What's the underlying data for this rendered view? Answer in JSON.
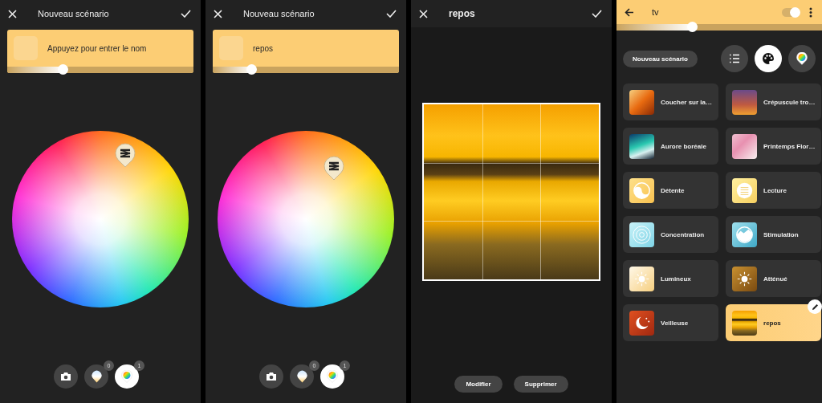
{
  "color_screens": [
    {
      "header": {
        "title": "Nouveau scénario"
      },
      "name_field": {
        "placeholder": "Appuyez pour entrer le nom"
      },
      "brightness": {
        "level": 0.3
      },
      "tools": [
        {
          "kind": "camera",
          "selected": false
        },
        {
          "kind": "white_pin",
          "badge": "0",
          "selected": false
        },
        {
          "kind": "color_pin",
          "badge": "1",
          "selected": true
        }
      ]
    },
    {
      "header": {
        "title": "Nouveau scénario"
      },
      "name_field": {
        "value": "repos"
      },
      "brightness": {
        "level": 0.21
      },
      "tools": [
        {
          "kind": "camera",
          "selected": false
        },
        {
          "kind": "white_pin",
          "badge": "0",
          "selected": false
        },
        {
          "kind": "color_pin",
          "badge": "1",
          "selected": true
        }
      ]
    }
  ],
  "crop_screen": {
    "header": {
      "title": "repos"
    },
    "buttons": [
      "Modifier",
      "Supprimer"
    ]
  },
  "room_screen": {
    "header": {
      "title": "tv",
      "toggle": {
        "on": true
      }
    },
    "brightness": {
      "level": 0.37
    },
    "new_scene_button": "Nouveau scénario",
    "view_tabs": [
      {
        "kind": "list",
        "selected": false
      },
      {
        "kind": "palette",
        "selected": true
      },
      {
        "kind": "color_pin",
        "selected": false
      }
    ],
    "scenes": [
      {
        "name": "Coucher sur la…",
        "selected": false
      },
      {
        "name": "Crépuscule tro…",
        "selected": false
      },
      {
        "name": "Aurore boréale",
        "selected": false
      },
      {
        "name": "Printemps Flor…",
        "selected": false
      },
      {
        "name": "Détente",
        "selected": false
      },
      {
        "name": "Lecture",
        "selected": false
      },
      {
        "name": "Concentration",
        "selected": false
      },
      {
        "name": "Stimulation",
        "selected": false
      },
      {
        "name": "Lumineux",
        "selected": false
      },
      {
        "name": "Atténué",
        "selected": false
      },
      {
        "name": "Veilleuse",
        "selected": false
      },
      {
        "name": "repos",
        "selected": true
      }
    ]
  }
}
